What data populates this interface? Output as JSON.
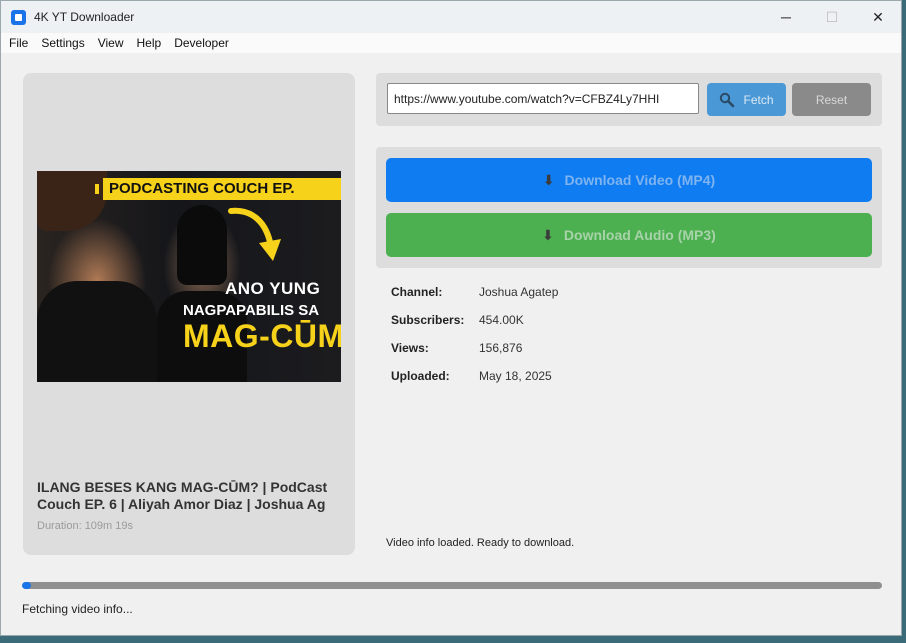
{
  "window": {
    "title": "4K YT Downloader",
    "minimize": "─",
    "maximize": "☐",
    "close": "✕"
  },
  "menu": [
    "File",
    "Settings",
    "View",
    "Help",
    "Developer"
  ],
  "thumbnail": {
    "banner": "PODCASTING COUCH EP.",
    "line1": "ANO YUNG",
    "line2": "NAGPAPABILIS SA",
    "line3": "MAG-CŪM"
  },
  "video": {
    "title": "ILANG BESES KANG MAG-CŪM? | PodCast\nCouch EP. 6 | Aliyah Amor Diaz | Joshua Ag",
    "duration": "Duration: 109m 19s"
  },
  "url": {
    "value": "https://www.youtube.com/watch?v=CFBZ4Ly7HHI"
  },
  "buttons": {
    "fetch": "Fetch",
    "reset": "Reset",
    "download_video": "Download Video (MP4)",
    "download_audio": "Download Audio (MP3)"
  },
  "info": [
    {
      "label": "Channel:",
      "value": "Joshua Agatep"
    },
    {
      "label": "Subscribers:",
      "value": "454.00K"
    },
    {
      "label": "Views:",
      "value": "156,876"
    },
    {
      "label": "Uploaded:",
      "value": "May 18, 2025"
    }
  ],
  "status": "Video info loaded. Ready to download.",
  "progress": {
    "fraction": 0.01
  },
  "bottom_status": "Fetching video info...",
  "colors": {
    "accent": "#1a73e8",
    "fetch": "#4a98d6",
    "reset": "#8a8a8a",
    "download_video": "#0f7cf2",
    "download_audio": "#4caf50"
  },
  "icons": [
    "app-icon",
    "search-icon",
    "download-icon"
  ]
}
